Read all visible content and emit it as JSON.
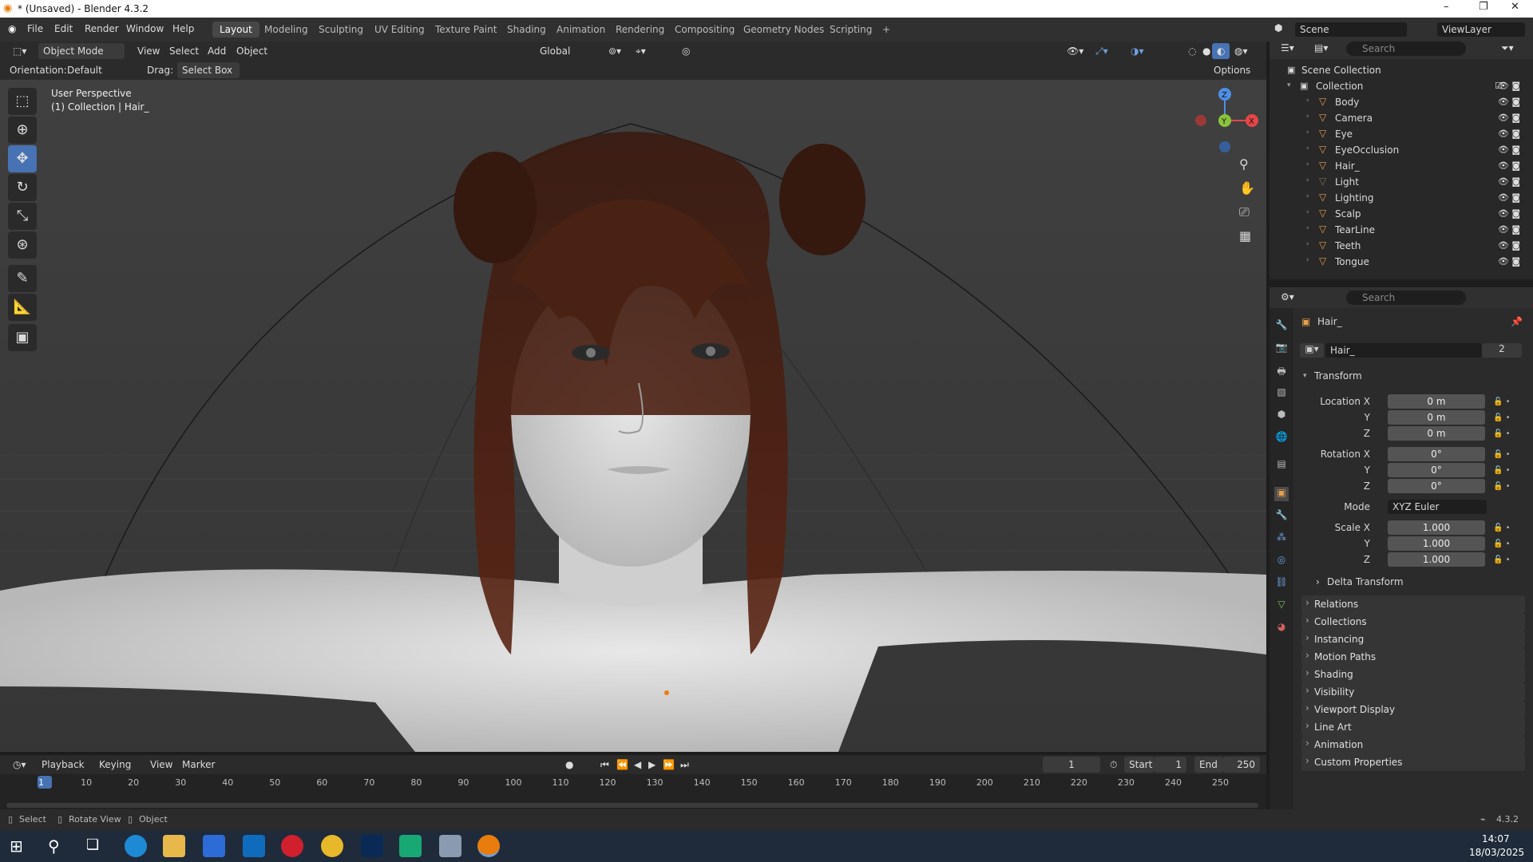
{
  "window": {
    "title": "* (Unsaved) - Blender 4.3.2",
    "controls": [
      "–",
      "❐",
      "✕"
    ]
  },
  "menu": {
    "items": [
      "File",
      "Edit",
      "Render",
      "Window",
      "Help"
    ]
  },
  "workspaces": [
    "Layout",
    "Modeling",
    "Sculpting",
    "UV Editing",
    "Texture Paint",
    "Shading",
    "Animation",
    "Rendering",
    "Compositing",
    "Geometry Nodes",
    "Scripting",
    "+"
  ],
  "scene": {
    "label": "Scene",
    "viewlayer": "ViewLayer"
  },
  "viewport_header": {
    "mode": "Object Mode",
    "view": "View",
    "select": "Select",
    "add": "Add",
    "object": "Object",
    "transform": "Global",
    "orientation_label": "Orientation:",
    "orientation": "Default",
    "drag_label": "Drag:",
    "drag": "Select Box",
    "options": "Options"
  },
  "viewport": {
    "line1": "User Perspective",
    "line2": "(1) Collection | Hair_",
    "gizmo": {
      "x": "X",
      "y": "Y",
      "z": "Z"
    }
  },
  "outliner": {
    "search_placeholder": "Search",
    "scene_collection": "Scene Collection",
    "collection": "Collection",
    "items": [
      {
        "name": "Body",
        "icon_color": "#e8a14c"
      },
      {
        "name": "Camera",
        "icon_color": "#e8a14c"
      },
      {
        "name": "Eye",
        "icon_color": "#e8a14c"
      },
      {
        "name": "EyeOcclusion",
        "icon_color": "#e8a14c"
      },
      {
        "name": "Hair_",
        "icon_color": "#e8a14c"
      },
      {
        "name": "Light",
        "icon_color": "#8a7050"
      },
      {
        "name": "Lighting",
        "icon_color": "#e8a14c"
      },
      {
        "name": "Scalp",
        "icon_color": "#e8a14c"
      },
      {
        "name": "TearLine",
        "icon_color": "#e8a14c"
      },
      {
        "name": "Teeth",
        "icon_color": "#e8a14c"
      },
      {
        "name": "Tongue",
        "icon_color": "#e8a14c"
      }
    ]
  },
  "properties": {
    "search_placeholder": "Search",
    "object_name": "Hair_",
    "datablock": "Hair_",
    "users": "2",
    "transform_label": "Transform",
    "location_label": "Location X",
    "loc": [
      "0 m",
      "0 m",
      "0 m"
    ],
    "rotation_label": "Rotation X",
    "rot": [
      "0°",
      "0°",
      "0°"
    ],
    "mode_label": "Mode",
    "mode": "XYZ Euler",
    "scale_label": "Scale X",
    "scale": [
      "1.000",
      "1.000",
      "1.000"
    ],
    "y": "Y",
    "z": "Z",
    "delta": "Delta Transform",
    "sections": [
      "Relations",
      "Collections",
      "Instancing",
      "Motion Paths",
      "Shading",
      "Visibility",
      "Viewport Display",
      "Line Art",
      "Animation",
      "Custom Properties"
    ]
  },
  "timeline": {
    "playback": "Playback",
    "keying": "Keying",
    "view": "View",
    "marker": "Marker",
    "current_frame": "1",
    "start_label": "Start",
    "start": "1",
    "end_label": "End",
    "end": "250",
    "ticks": [
      "1",
      "10",
      "20",
      "30",
      "40",
      "50",
      "60",
      "70",
      "80",
      "90",
      "100",
      "110",
      "120",
      "130",
      "140",
      "150",
      "160",
      "170",
      "180",
      "190",
      "200",
      "210",
      "220",
      "230",
      "240",
      "250"
    ]
  },
  "status": {
    "select": "Select",
    "rotate": "Rotate View",
    "object": "Object",
    "version": "4.3.2"
  },
  "clock": {
    "time": "14:07",
    "date": "18/03/2025"
  },
  "colors": {
    "accent": "#4772b3",
    "active_tool": "#4772b3",
    "x_axis": "#e64646",
    "y_axis": "#8ac33c",
    "z_axis": "#4d8fe6"
  }
}
